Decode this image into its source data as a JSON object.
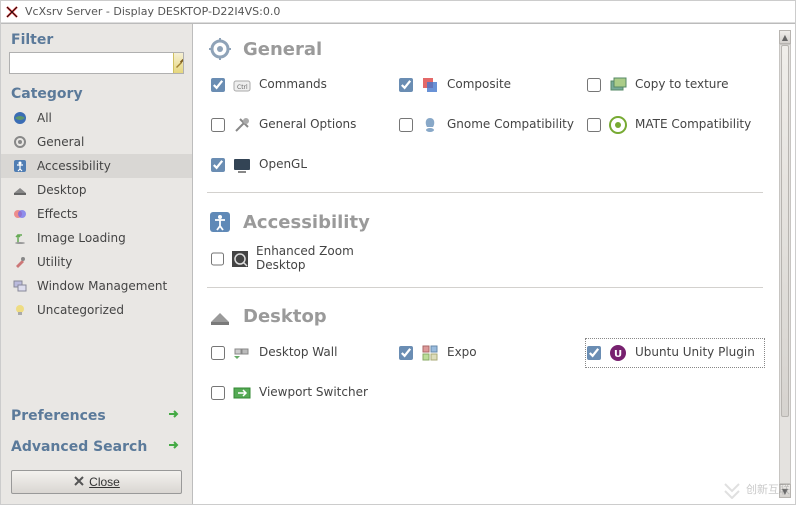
{
  "window": {
    "title": "VcXsrv Server - Display DESKTOP-D22I4VS:0.0"
  },
  "sidebar": {
    "filter_label": "Filter",
    "filter_value": "",
    "filter_placeholder": "",
    "category_label": "Category",
    "categories": [
      {
        "label": "All",
        "icon": "globe"
      },
      {
        "label": "General",
        "icon": "gear"
      },
      {
        "label": "Accessibility",
        "icon": "accessibility"
      },
      {
        "label": "Desktop",
        "icon": "desktop"
      },
      {
        "label": "Effects",
        "icon": "effects"
      },
      {
        "label": "Image Loading",
        "icon": "image"
      },
      {
        "label": "Utility",
        "icon": "utility"
      },
      {
        "label": "Window Management",
        "icon": "windows"
      },
      {
        "label": "Uncategorized",
        "icon": "bulb"
      }
    ],
    "preferences_label": "Preferences",
    "advanced_label": "Advanced Search",
    "close_label": "Close"
  },
  "sections": {
    "general": {
      "title": "General",
      "plugins": [
        {
          "label": "Commands",
          "checked": true,
          "icon": "commands"
        },
        {
          "label": "Composite",
          "checked": true,
          "icon": "composite"
        },
        {
          "label": "Copy to texture",
          "checked": false,
          "icon": "copytex"
        },
        {
          "label": "General Options",
          "checked": false,
          "icon": "tools"
        },
        {
          "label": "Gnome Compatibility",
          "checked": false,
          "icon": "gnome"
        },
        {
          "label": "MATE Compatibility",
          "checked": false,
          "icon": "mate"
        },
        {
          "label": "OpenGL",
          "checked": true,
          "icon": "opengl"
        }
      ]
    },
    "accessibility": {
      "title": "Accessibility",
      "plugins": [
        {
          "label": "Enhanced Zoom Desktop",
          "checked": false,
          "icon": "zoom"
        }
      ]
    },
    "desktop": {
      "title": "Desktop",
      "plugins": [
        {
          "label": "Desktop Wall",
          "checked": false,
          "icon": "wall"
        },
        {
          "label": "Expo",
          "checked": true,
          "icon": "expo"
        },
        {
          "label": "Ubuntu Unity Plugin",
          "checked": true,
          "icon": "unity",
          "focused": true
        },
        {
          "label": "Viewport Switcher",
          "checked": false,
          "icon": "viewport"
        }
      ]
    }
  },
  "watermark": "创新互联"
}
